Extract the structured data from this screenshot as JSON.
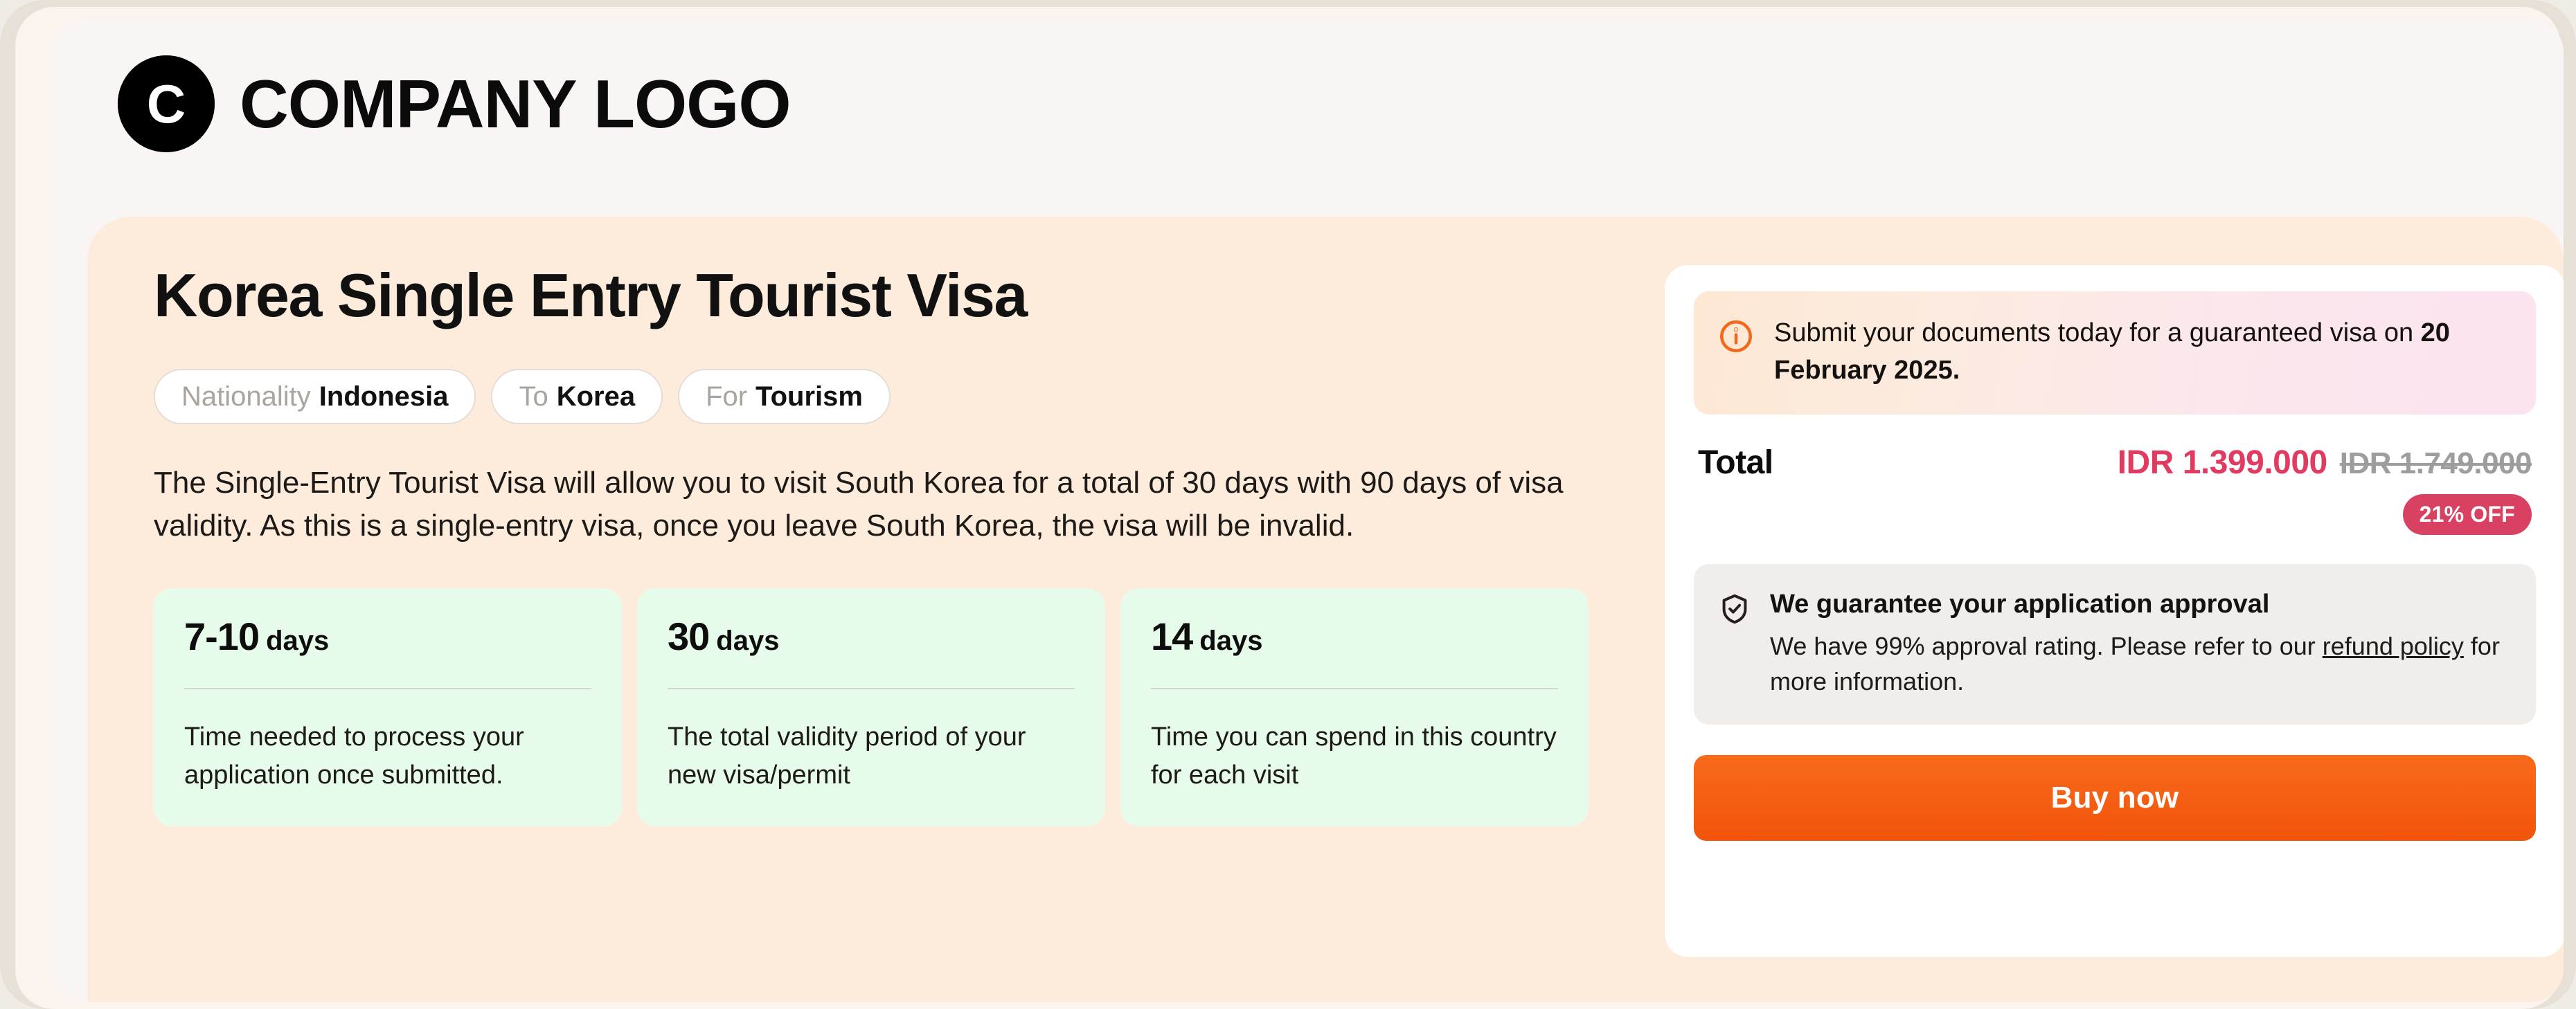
{
  "brand": {
    "logo_letter": "C",
    "logo_text": "COMPANY LOGO",
    "logo_icon": "circle-c-logo-icon"
  },
  "product": {
    "title": "Korea Single Entry Tourist Visa",
    "tags": [
      {
        "key": "Nationality",
        "value": "Indonesia"
      },
      {
        "key": "To",
        "value": "Korea"
      },
      {
        "key": "For",
        "value": "Tourism"
      }
    ],
    "description": "The Single-Entry Tourist Visa will allow you to visit South Korea for a total of 30 days with 90 days of visa validity. As this is a single-entry visa, once you leave South Korea, the visa will be invalid.",
    "stats": [
      {
        "number": "7-10",
        "unit": "days",
        "text": "Time needed to process your application once submitted."
      },
      {
        "number": "30",
        "unit": "days",
        "text": "The total validity period of your new visa/permit"
      },
      {
        "number": "14",
        "unit": "days",
        "text": "Time you can spend in this country for each visit"
      }
    ]
  },
  "purchase": {
    "alert": {
      "icon": "info-circle-icon",
      "text_before": "Submit your documents today for a guaranteed visa on ",
      "date": "20 February 2025."
    },
    "total_label": "Total",
    "price_current": "IDR 1.399.000",
    "price_original": "IDR 1.749.000",
    "discount_badge": "21% OFF",
    "guarantee": {
      "icon": "shield-check-icon",
      "title": "We guarantee your application approval",
      "body_before": "We have 99% approval rating. Please refer to our ",
      "link": "refund policy",
      "body_after": " for more information."
    },
    "buy_button": "Buy now"
  },
  "colors": {
    "accent_orange": "#F1540A",
    "price_red": "#E23B62",
    "badge_pink": "#D94163",
    "panel_peach": "#FDECDC",
    "stat_green": "#E6FBEA",
    "page_bg": "#FBF3EE"
  }
}
